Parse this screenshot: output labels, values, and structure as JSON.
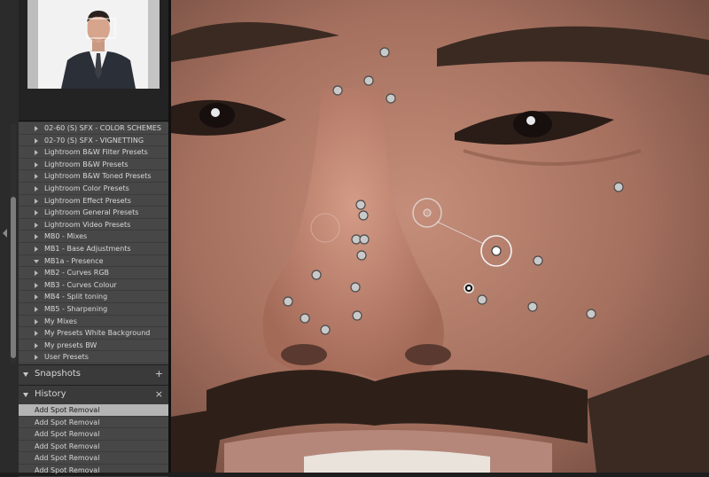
{
  "presets": {
    "items": [
      {
        "label": "02-60 (S) SFX - COLOR SCHEMES",
        "expanded": false
      },
      {
        "label": "02-70 (S) SFX - VIGNETTING",
        "expanded": false
      },
      {
        "label": "Lightroom B&W Filter Presets",
        "expanded": false
      },
      {
        "label": "Lightroom B&W Presets",
        "expanded": false
      },
      {
        "label": "Lightroom B&W Toned Presets",
        "expanded": false
      },
      {
        "label": "Lightroom Color Presets",
        "expanded": false
      },
      {
        "label": "Lightroom Effect Presets",
        "expanded": false
      },
      {
        "label": "Lightroom General Presets",
        "expanded": false
      },
      {
        "label": "Lightroom Video Presets",
        "expanded": false
      },
      {
        "label": "MB0 - Mixes",
        "expanded": false
      },
      {
        "label": "MB1 - Base Adjustments",
        "expanded": false
      },
      {
        "label": "MB1a - Presence",
        "expanded": true
      },
      {
        "label": "MB2 - Curves RGB",
        "expanded": false
      },
      {
        "label": "MB3 - Curves Colour",
        "expanded": false
      },
      {
        "label": "MB4 - Split toning",
        "expanded": false
      },
      {
        "label": "MB5 - Sharpening",
        "expanded": false
      },
      {
        "label": "My Mixes",
        "expanded": false
      },
      {
        "label": "My Presets White Background",
        "expanded": false
      },
      {
        "label": "My presets BW",
        "expanded": false
      },
      {
        "label": "User Presets",
        "expanded": false
      }
    ]
  },
  "snapshots": {
    "title": "Snapshots",
    "action": "+"
  },
  "history": {
    "title": "History",
    "action": "×",
    "items": [
      {
        "label": "Add Spot Removal",
        "selected": true
      },
      {
        "label": "Add Spot Removal",
        "selected": false
      },
      {
        "label": "Add Spot Removal",
        "selected": false
      },
      {
        "label": "Add Spot Removal",
        "selected": false
      },
      {
        "label": "Add Spot Removal",
        "selected": false
      },
      {
        "label": "Add Spot Removal",
        "selected": false
      }
    ]
  },
  "icons": {
    "collapse": "left-arrow-icon",
    "expand": "disclosure-triangle-icon",
    "add": "plus-icon",
    "clear": "close-icon",
    "spot": "spot-removal-pin-icon"
  },
  "colors": {
    "panel_bg": "#3a3a3a",
    "list_bg": "#474747",
    "selected_row": "#b4b4b4",
    "pin_fill": "#c9c9c9"
  }
}
